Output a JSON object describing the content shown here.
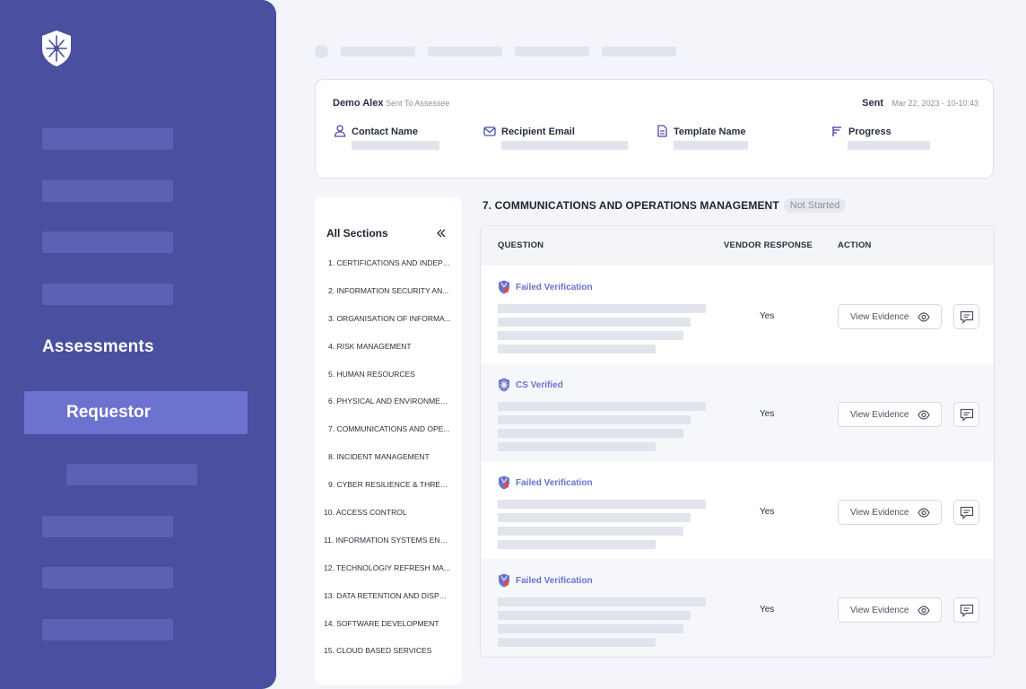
{
  "sidebar": {
    "heading": "Assessments",
    "active_item": "Requestor"
  },
  "header": {
    "name": "Demo Alex",
    "status": "Sent To Assessee",
    "sent_label": "Sent",
    "sent_date": "Mar 22, 2023 - 10-10:43",
    "fields": [
      {
        "label": "Contact Name",
        "icon": "user-icon"
      },
      {
        "label": "Recipient Email",
        "icon": "mail-icon"
      },
      {
        "label": "Template Name",
        "icon": "document-icon"
      },
      {
        "label": "Progress",
        "icon": "progress-icon"
      }
    ]
  },
  "sections": {
    "title": "All Sections",
    "items": [
      "1. CERTIFICATIONS AND INDEPE...",
      "2. INFORMATION SECURITY AN...",
      "3. ORGANISATION OF INFORMA...",
      "4. RISK MANAGEMENT",
      "5. HUMAN RESOURCES",
      "6. PHYSICAL AND ENVIRONMEN...",
      "7. COMMUNICATIONS AND OPE...",
      "8. INCIDENT MANAGEMENT",
      "9. CYBER RESILIENCE & THREAT...",
      "10. ACCESS CONTROL",
      "11. INFORMATION SYSTEMS ENVI...",
      "12. TECHNOLOGIY REFRESH MA...",
      "13. DATA RETENTION AND DISPO...",
      "14. SOFTWARE DEVELOPMENT",
      "15. CLOUD BASED SERVICES"
    ]
  },
  "main": {
    "title": "7. COMMUNICATIONS AND OPERATIONS MANAGEMENT",
    "badge": "Not Started",
    "columns": [
      "QUESTION",
      "VENDOR RESPONSE",
      "ACTION"
    ],
    "rows": [
      {
        "status": "Failed Verification",
        "response": "Yes",
        "action": "View Evidence"
      },
      {
        "status": "CS Verified",
        "response": "Yes",
        "action": "View Evidence"
      },
      {
        "status": "Failed Verification",
        "response": "Yes",
        "action": "View Evidence"
      },
      {
        "status": "Failed Verification",
        "response": "Yes",
        "action": "View Evidence"
      }
    ]
  },
  "colors": {
    "sidebar_bg": "#4a4f9f",
    "sidebar_active": "#6b72cf",
    "accent": "#6b72cf",
    "shield_red": "#e5484d",
    "page_bg": "#f3f5fa"
  }
}
